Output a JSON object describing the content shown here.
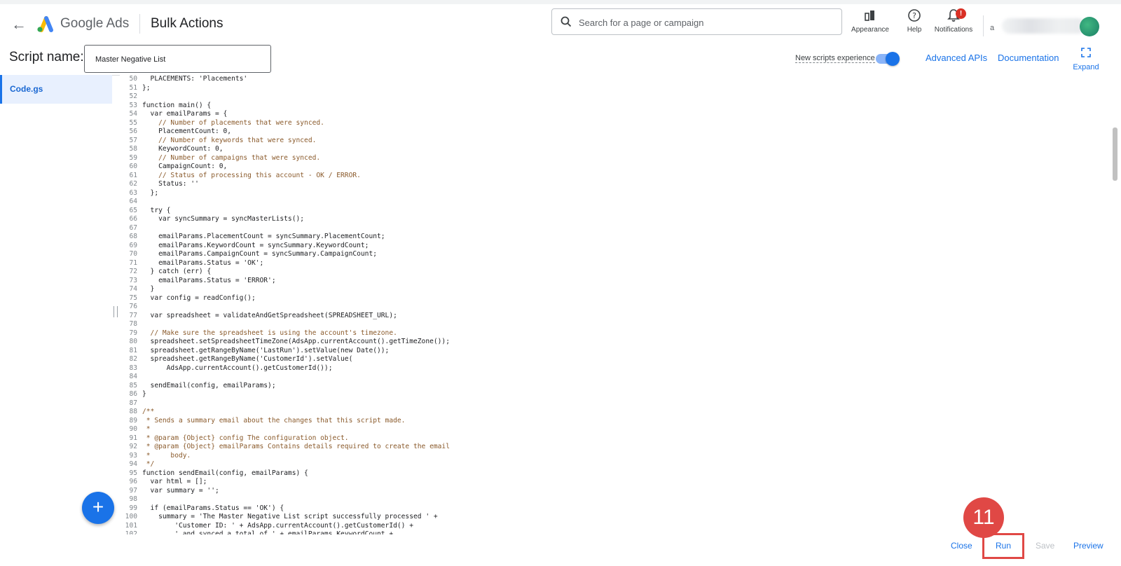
{
  "header": {
    "brand": "Google Ads",
    "page_title": "Bulk Actions",
    "search_placeholder": "Search for a page or campaign",
    "icons": [
      {
        "label": "Appearance",
        "icon": "appearance-icon"
      },
      {
        "label": "Help",
        "icon": "help-icon"
      },
      {
        "label": "Notifications",
        "icon": "bell-icon"
      }
    ],
    "notification_badge": "!",
    "account_text": "a",
    "colors": {
      "blue": "#1a73e8",
      "red": "#d93025",
      "step": "#e04845"
    }
  },
  "script_bar": {
    "label": "Script name:",
    "name_value": "Master Negative List",
    "new_experience_label": "New scripts experience",
    "new_experience_on": true,
    "advanced_apis": "Advanced APIs",
    "documentation": "Documentation",
    "expand": "Expand"
  },
  "sidebar": {
    "file_tab": "Code.gs"
  },
  "editor": {
    "lines": [
      {
        "no": "50",
        "text": "  PLACEMENTS: 'Placements'"
      },
      {
        "no": "51",
        "text": "};"
      },
      {
        "no": "52",
        "text": ""
      },
      {
        "no": "53",
        "text": "function main() {"
      },
      {
        "no": "54",
        "text": "  var emailParams = {"
      },
      {
        "no": "55",
        "text": "    // Number of placements that were synced."
      },
      {
        "no": "56",
        "text": "    PlacementCount: 0,"
      },
      {
        "no": "57",
        "text": "    // Number of keywords that were synced."
      },
      {
        "no": "58",
        "text": "    KeywordCount: 0,"
      },
      {
        "no": "59",
        "text": "    // Number of campaigns that were synced."
      },
      {
        "no": "60",
        "text": "    CampaignCount: 0,"
      },
      {
        "no": "61",
        "text": "    // Status of processing this account - OK / ERROR."
      },
      {
        "no": "62",
        "text": "    Status: ''"
      },
      {
        "no": "63",
        "text": "  };"
      },
      {
        "no": "64",
        "text": ""
      },
      {
        "no": "65",
        "text": "  try {"
      },
      {
        "no": "66",
        "text": "    var syncSummary = syncMasterLists();"
      },
      {
        "no": "67",
        "text": ""
      },
      {
        "no": "68",
        "text": "    emailParams.PlacementCount = syncSummary.PlacementCount;"
      },
      {
        "no": "69",
        "text": "    emailParams.KeywordCount = syncSummary.KeywordCount;"
      },
      {
        "no": "70",
        "text": "    emailParams.CampaignCount = syncSummary.CampaignCount;"
      },
      {
        "no": "71",
        "text": "    emailParams.Status = 'OK';"
      },
      {
        "no": "72",
        "text": "  } catch (err) {"
      },
      {
        "no": "73",
        "text": "    emailParams.Status = 'ERROR';"
      },
      {
        "no": "74",
        "text": "  }"
      },
      {
        "no": "75",
        "text": "  var config = readConfig();"
      },
      {
        "no": "76",
        "text": ""
      },
      {
        "no": "77",
        "text": "  var spreadsheet = validateAndGetSpreadsheet(SPREADSHEET_URL);"
      },
      {
        "no": "78",
        "text": ""
      },
      {
        "no": "79",
        "text": "  // Make sure the spreadsheet is using the account's timezone."
      },
      {
        "no": "80",
        "text": "  spreadsheet.setSpreadsheetTimeZone(AdsApp.currentAccount().getTimeZone());"
      },
      {
        "no": "81",
        "text": "  spreadsheet.getRangeByName('LastRun').setValue(new Date());"
      },
      {
        "no": "82",
        "text": "  spreadsheet.getRangeByName('CustomerId').setValue("
      },
      {
        "no": "83",
        "text": "      AdsApp.currentAccount().getCustomerId());"
      },
      {
        "no": "84",
        "text": ""
      },
      {
        "no": "85",
        "text": "  sendEmail(config, emailParams);"
      },
      {
        "no": "86",
        "text": "}"
      },
      {
        "no": "87",
        "text": ""
      },
      {
        "no": "88",
        "text": "/**"
      },
      {
        "no": "89",
        "text": " * Sends a summary email about the changes that this script made."
      },
      {
        "no": "90",
        "text": " *"
      },
      {
        "no": "91",
        "text": " * @param {Object} config The configuration object."
      },
      {
        "no": "92",
        "text": " * @param {Object} emailParams Contains details required to create the email"
      },
      {
        "no": "93",
        "text": " *     body."
      },
      {
        "no": "94",
        "text": " */"
      },
      {
        "no": "95",
        "text": "function sendEmail(config, emailParams) {"
      },
      {
        "no": "96",
        "text": "  var html = [];"
      },
      {
        "no": "97",
        "text": "  var summary = '';"
      },
      {
        "no": "98",
        "text": ""
      },
      {
        "no": "99",
        "text": "  if (emailParams.Status == 'OK') {"
      },
      {
        "no": "100",
        "text": "    summary = 'The Master Negative List script successfully processed ' +"
      },
      {
        "no": "101",
        "text": "        'Customer ID: ' + AdsApp.currentAccount().getCustomerId() +"
      },
      {
        "no": "102",
        "text": "        ' and synced a total of ' + emailParams.KeywordCount +"
      }
    ]
  },
  "footer": {
    "close": "Close",
    "run": "Run",
    "save": "Save",
    "preview": "Preview"
  },
  "annotation": {
    "step_number": "11"
  }
}
